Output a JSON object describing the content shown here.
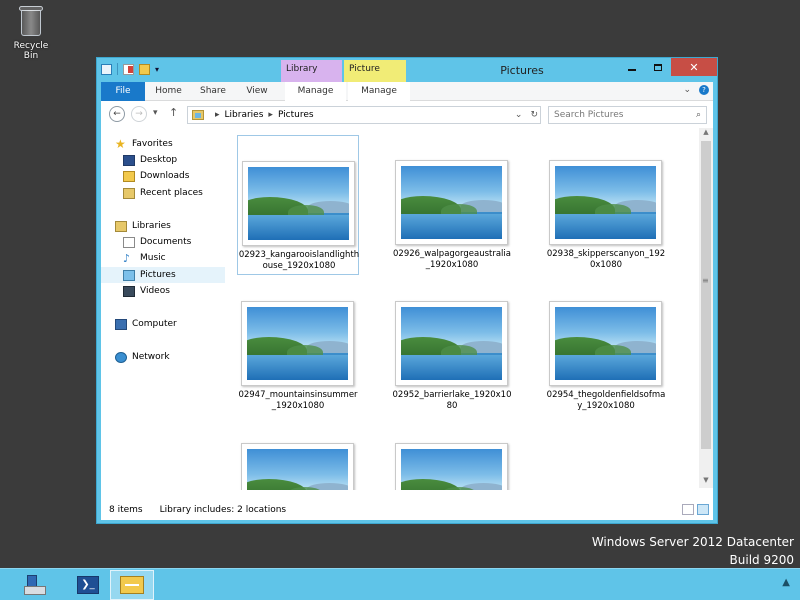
{
  "desktop": {
    "recycle_bin_label": "Recycle Bin",
    "watermark_line1": "Windows Server 2012 Datacenter",
    "watermark_line2": "Build 9200"
  },
  "window": {
    "title": "Pictures",
    "context_tabs": {
      "library_tools": "Library Tools",
      "picture_tools": "Picture Tools"
    },
    "ribbon_tabs": [
      "File",
      "Home",
      "Share",
      "View",
      "Manage",
      "Manage"
    ],
    "address": {
      "segments": [
        "Libraries",
        "Pictures"
      ]
    },
    "search_placeholder": "Search Pictures",
    "colors": {
      "titlebar": "#5fc4e8",
      "file_tab": "#1979ca",
      "library_tools": "#d8b3ee",
      "picture_tools": "#f1ec76",
      "close": "#c74e45"
    }
  },
  "sidebar": {
    "favorites": "Favorites",
    "desktop": "Desktop",
    "downloads": "Downloads",
    "recent": "Recent places",
    "libraries": "Libraries",
    "documents": "Documents",
    "music": "Music",
    "pictures": "Pictures",
    "videos": "Videos",
    "computer": "Computer",
    "network": "Network"
  },
  "files": [
    {
      "name": "02923_kangarooislandlighthouse_1920x1080"
    },
    {
      "name": "02926_walpagorgeaustralia_1920x1080"
    },
    {
      "name": "02938_skipperscanyon_1920x1080"
    },
    {
      "name": "02947_mountainsinsummer_1920x1080"
    },
    {
      "name": "02952_barrierlake_1920x1080"
    },
    {
      "name": "02954_thegoldenfieldsofmay_1920x1080"
    },
    {
      "name": ""
    },
    {
      "name": ""
    }
  ],
  "status": {
    "item_count": "8 items",
    "library_includes": "Library includes: 2 locations"
  }
}
